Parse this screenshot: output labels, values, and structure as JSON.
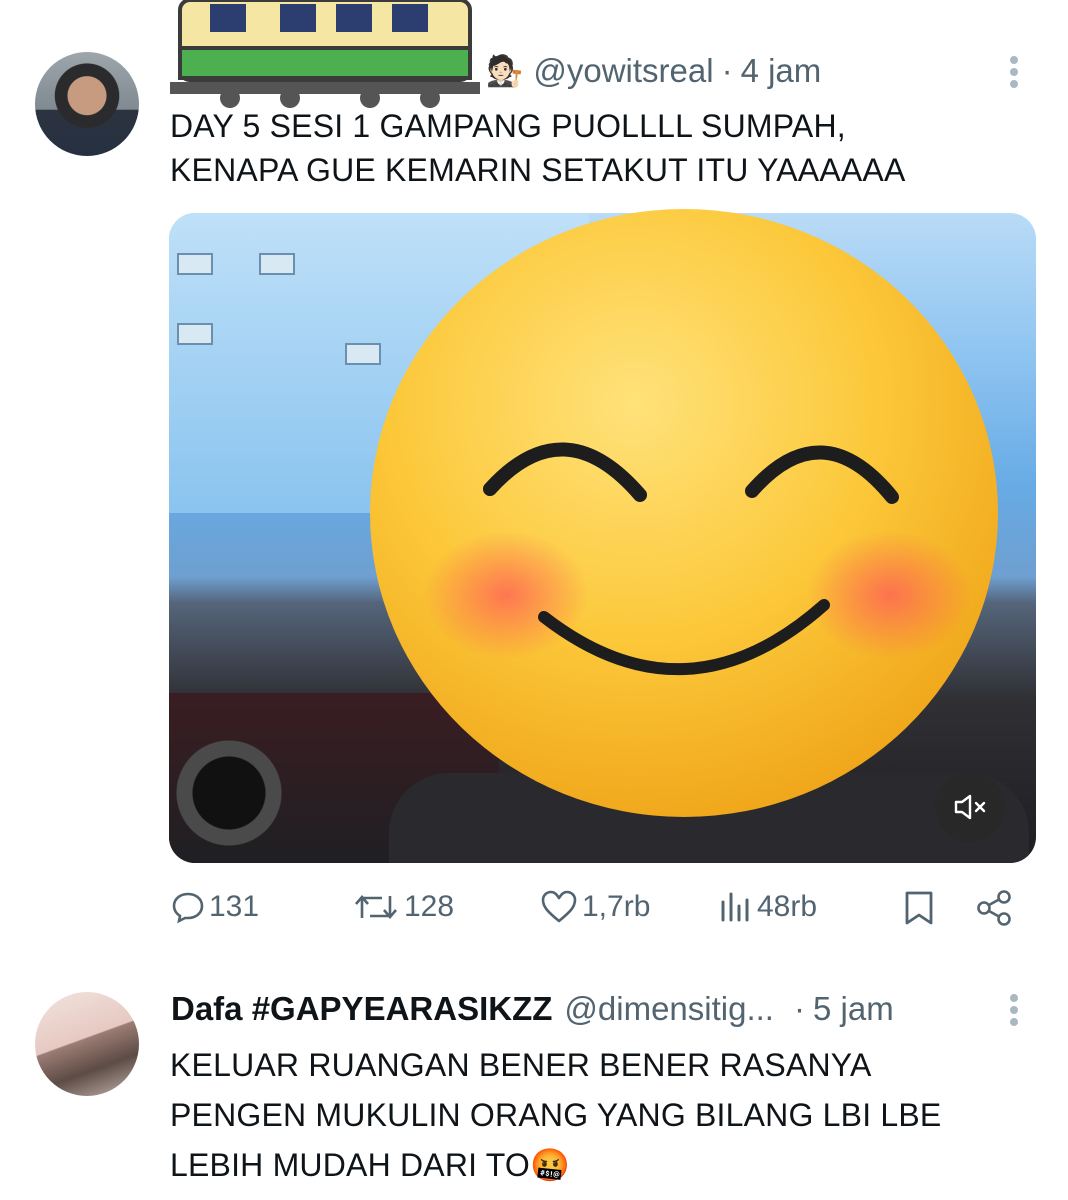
{
  "tweets": [
    {
      "display_name": "",
      "name_emojis": "🧑🏻‍⚖️",
      "handle": "@yowitsreal",
      "separator": "·",
      "time": "4 jam",
      "text_lines": [
        "DAY 5 SESI 1 GAMPANG PUOLLLL SUMPAH,",
        "KENAPA GUE KEMARIN SETAKUT ITU YAAAAAA"
      ],
      "media": {
        "type": "video",
        "sticker": "smiling-face-with-blush-emoji",
        "mute_icon": "muted-speaker-icon"
      },
      "actions": {
        "replies": "131",
        "retweets": "128",
        "likes": "1,7rb",
        "views": "48rb"
      }
    },
    {
      "display_name": "Dafa #GAPYEARASIKZZ",
      "handle": "@dimensitig...",
      "separator": "·",
      "time": "5 jam",
      "text_lines": [
        "KELUAR RUANGAN BENER BENER RASANYA",
        "PENGEN MUKULIN ORANG YANG BILANG LBI LBE",
        "LEBIH MUDAH DARI TO"
      ],
      "trailing_emoji": "🤬"
    }
  ],
  "colors": {
    "text": "#0f1419",
    "muted": "#536471",
    "more_dots": "#aab8c2"
  },
  "icons": {
    "reply": "speech-bubble-icon",
    "retweet": "retweet-arrows-icon",
    "like": "heart-icon",
    "views": "bar-chart-icon",
    "bookmark": "bookmark-icon",
    "share": "share-nodes-icon",
    "more": "vertical-dots-icon"
  }
}
